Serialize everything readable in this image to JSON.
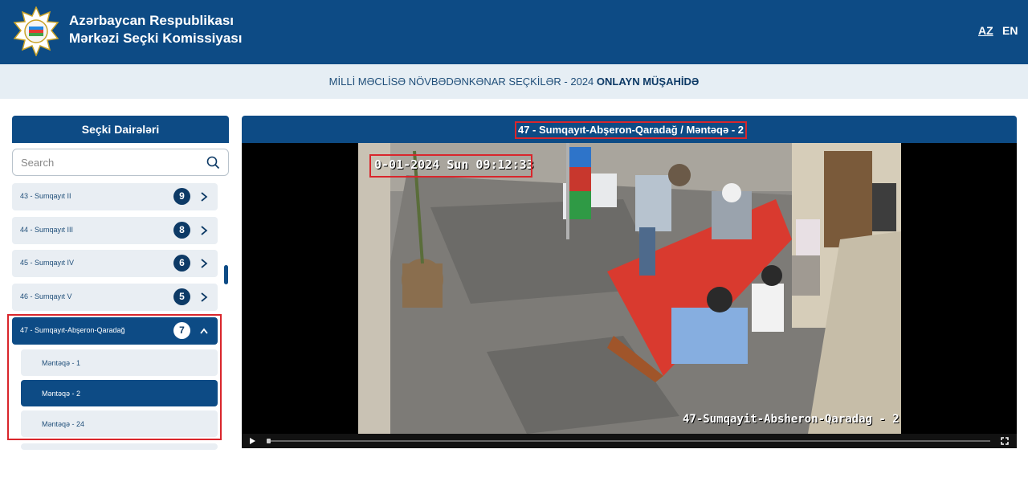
{
  "header": {
    "org_line1": "Azərbaycan Respublikası",
    "org_line2": "Mərkəzi Seçki Komissiyası",
    "logo_icon": "seal-logo-icon",
    "lang_az": "AZ",
    "lang_en": "EN"
  },
  "banner": {
    "text": "MİLLİ MƏCLİSƏ NÖVBƏDƏNKƏNAR SEÇKİLƏR - 2024",
    "strong": "ONLAYN MÜŞAHİDƏ"
  },
  "sidebar": {
    "title": "Seçki Dairələri",
    "search_placeholder": "Search",
    "districts": [
      {
        "label": "43 - Sumqayıt II",
        "count": "9"
      },
      {
        "label": "44 - Sumqayıt III",
        "count": "8"
      },
      {
        "label": "45 - Sumqayıt IV",
        "count": "6"
      },
      {
        "label": "46 - Sumqayıt V",
        "count": "5"
      },
      {
        "label": "47 - Sumqayıt-Abşeron-Qaradağ",
        "count": "7"
      }
    ],
    "stations": [
      {
        "label": "Məntəqə - 1"
      },
      {
        "label": "Məntəqə - 2"
      },
      {
        "label": "Məntəqə - 24"
      }
    ]
  },
  "video": {
    "title": "47 - Sumqayıt-Abşeron-Qaradağ / Məntəqə - 2",
    "timestamp": "0-01-2024 Sun 09:12:33",
    "overlay_name": "47-Sumqayit-Absheron-Qaradag - 2"
  },
  "colors": {
    "primary": "#0d4b85",
    "banner_bg": "#e6eef4",
    "highlight": "#d9262c"
  }
}
